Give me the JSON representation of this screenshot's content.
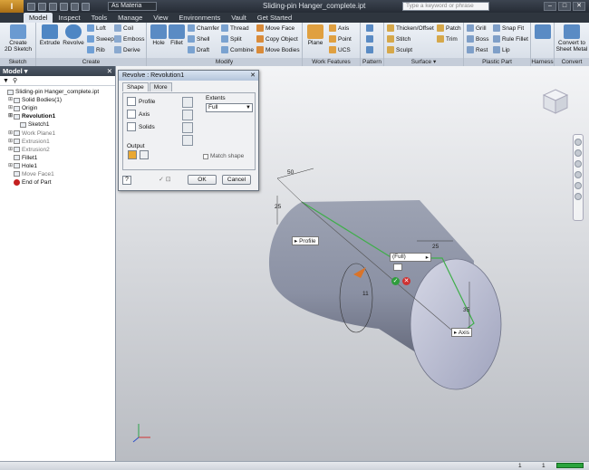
{
  "app": {
    "material": "As Materia",
    "doc_title": "Sliding-pin Hanger_complete.ipt",
    "search_placeholder": "Type a keyword or phrase"
  },
  "ribbon_tabs": [
    "Model",
    "Inspect",
    "Tools",
    "Manage",
    "View",
    "Environments",
    "Vault",
    "Get Started"
  ],
  "ribbon": {
    "sketch_group": {
      "create_sketch": "Create\n2D Sketch",
      "label": "Sketch"
    },
    "create_group": {
      "extrude": "Extrude",
      "revolve": "Revolve",
      "loft": "Loft",
      "sweep": "Sweep",
      "rib": "Rib",
      "coil": "Coil",
      "emboss": "Emboss",
      "derive": "Derive",
      "label": "Create"
    },
    "modify_group": {
      "hole": "Hole",
      "fillet": "Fillet",
      "chamfer": "Chamfer",
      "shell": "Shell",
      "draft": "Draft",
      "thread": "Thread",
      "split": "Split",
      "combine": "Combine",
      "move_face": "Move Face",
      "copy_object": "Copy Object",
      "move_bodies": "Move Bodies",
      "label": "Modify"
    },
    "work_group": {
      "plane": "Plane",
      "axis": "Axis",
      "point": "Point",
      "ucs": "UCS",
      "label": "Work Features"
    },
    "pattern_group": {
      "label": "Pattern"
    },
    "surface_group": {
      "thicken": "Thicken/Offset",
      "stitch": "Stitch",
      "sculpt": "Sculpt",
      "patch": "Patch",
      "trim": "Trim",
      "label": "Surface"
    },
    "plastic_group": {
      "grill": "Grill",
      "boss": "Boss",
      "rest": "Rest",
      "snap_fit": "Snap Fit",
      "rule_fillet": "Rule Fillet",
      "lip": "Lip",
      "label": "Plastic Part"
    },
    "harness_group": {
      "label": "Harness"
    },
    "convert_group": {
      "convert": "Convert to\nSheet Metal",
      "label": "Convert"
    }
  },
  "browser": {
    "title": "Model",
    "items": [
      {
        "label": "Sliding-pin Hanger_complete.ipt",
        "indent": 0
      },
      {
        "label": "Solid Bodies(1)",
        "indent": 1
      },
      {
        "label": "Origin",
        "indent": 1
      },
      {
        "label": "Revolution1",
        "indent": 1
      },
      {
        "label": "Sketch1",
        "indent": 2
      },
      {
        "label": "Work Plane1",
        "indent": 1
      },
      {
        "label": "Extrusion1",
        "indent": 1
      },
      {
        "label": "Extrusion2",
        "indent": 1
      },
      {
        "label": "Fillet1",
        "indent": 1
      },
      {
        "label": "Hole1",
        "indent": 1
      },
      {
        "label": "Move Face1",
        "indent": 1
      },
      {
        "label": "End of Part",
        "indent": 1
      }
    ]
  },
  "dialog": {
    "title": "Revolve : Revolution1",
    "tabs": [
      "Shape",
      "More"
    ],
    "profile": "Profile",
    "axis": "Axis",
    "solids": "Solids",
    "output": "Output",
    "extents_label": "Extents",
    "extents_value": "Full",
    "match_shape": "Match shape",
    "ok": "OK",
    "cancel": "Cancel"
  },
  "viewport": {
    "dim_50": "50",
    "dim_25a": "25",
    "dim_25b": "25",
    "dim_35": "35",
    "dim_11": "11",
    "profile_tag": "Profile",
    "axis_tag": "Axis",
    "full_tag": "(Full)"
  },
  "status": {
    "n1": "1",
    "n2": "1"
  }
}
